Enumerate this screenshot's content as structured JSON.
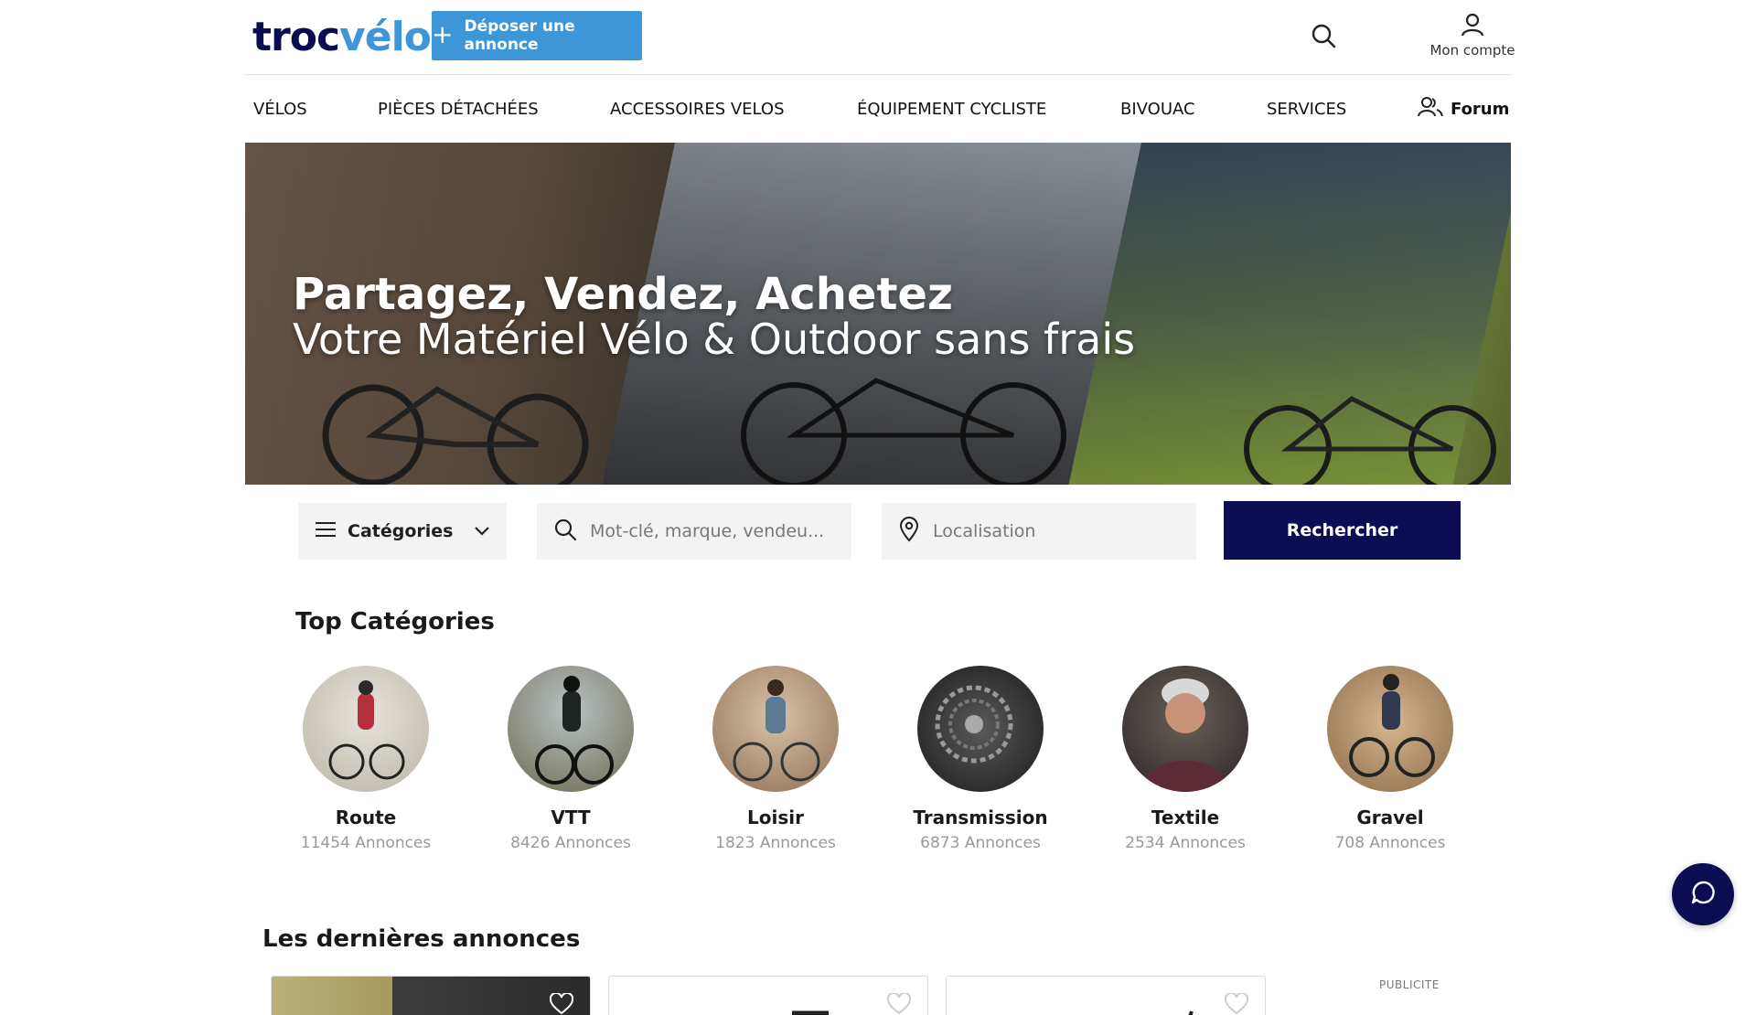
{
  "header": {
    "logo_part1": "troc",
    "logo_part2": "vélo",
    "deposit_label": "Déposer une annonce",
    "account_label": "Mon compte"
  },
  "nav": {
    "items": [
      "VÉLOS",
      "PIÈCES DÉTACHÉES",
      "ACCESSOIRES VELOS",
      "ÉQUIPEMENT CYCLISTE",
      "BIVOUAC",
      "SERVICES"
    ],
    "forum_label": "Forum"
  },
  "hero": {
    "title": "Partagez, Vendez, Achetez",
    "subtitle": "Votre Matériel Vélo & Outdoor sans frais"
  },
  "search": {
    "categories_label": "Catégories",
    "keyword_placeholder": "Mot-clé, marque, vendeu...",
    "location_placeholder": "Localisation",
    "button_label": "Rechercher"
  },
  "top_categories": {
    "title": "Top Catégories",
    "items": [
      {
        "name": "Route",
        "count": "11454 Annonces"
      },
      {
        "name": "VTT",
        "count": "8426 Annonces"
      },
      {
        "name": "Loisir",
        "count": "1823 Annonces"
      },
      {
        "name": "Transmission",
        "count": "6873 Annonces"
      },
      {
        "name": "Textile",
        "count": "2534 Annonces"
      },
      {
        "name": "Gravel",
        "count": "708 Annonces"
      }
    ]
  },
  "latest": {
    "title": "Les dernières annonces",
    "ad_label": "PUBLICITE"
  },
  "colors": {
    "brand_dark": "#0c0c52",
    "brand_light": "#3d96d8"
  },
  "icons": [
    "plus-icon",
    "search-icon",
    "user-icon",
    "users-icon",
    "menu-icon",
    "chevron-down-icon",
    "location-pin-icon",
    "chat-icon",
    "heart-icon"
  ]
}
